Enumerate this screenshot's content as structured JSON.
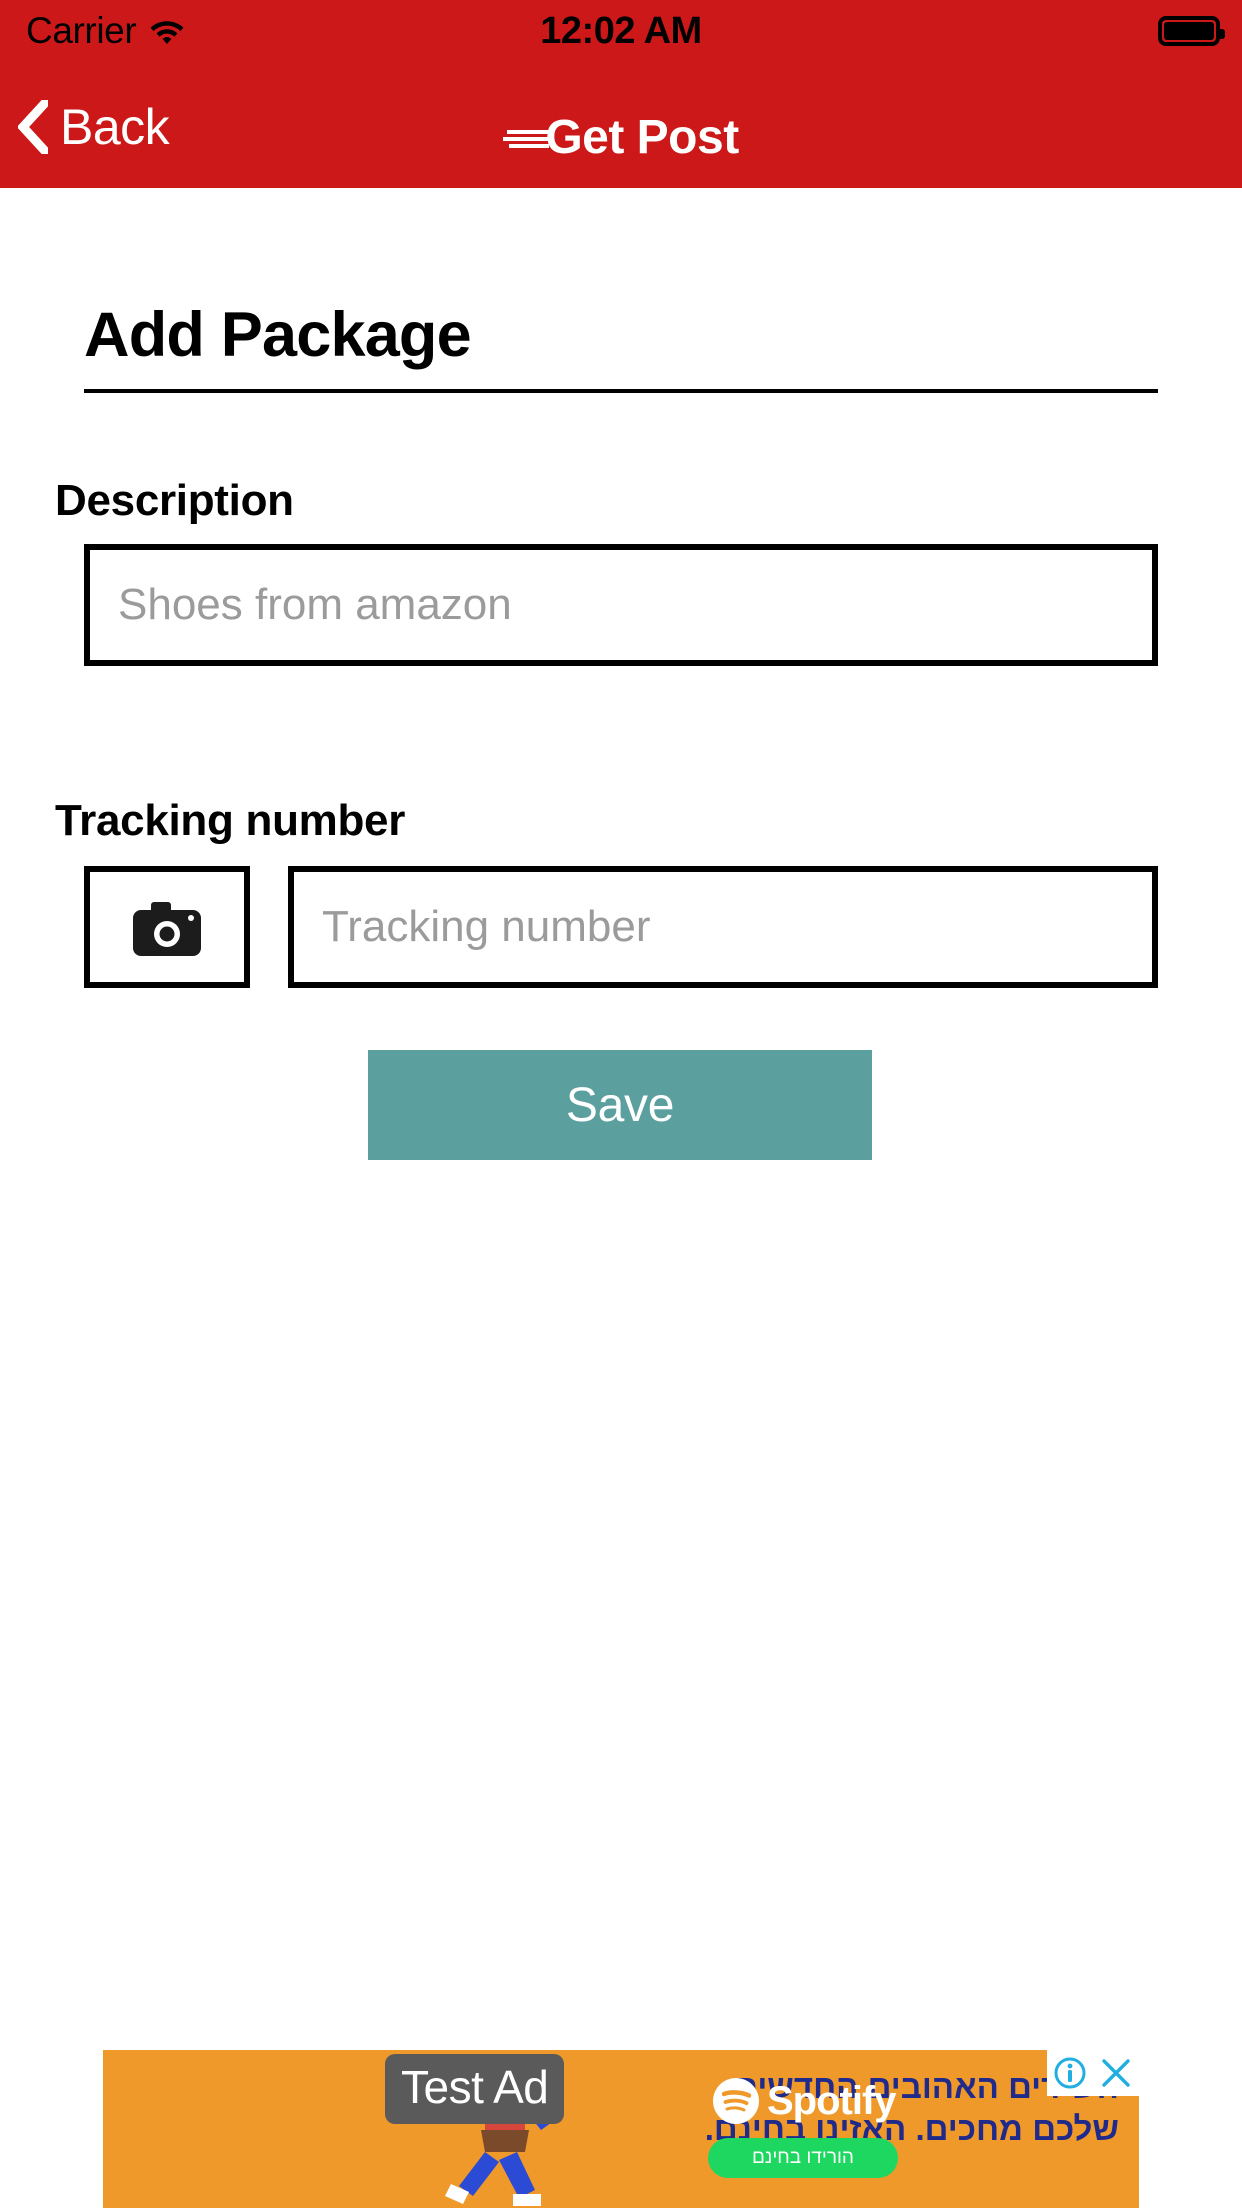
{
  "status_bar": {
    "carrier": "Carrier",
    "wifi_icon": "wifi-icon",
    "time": "12:02 AM",
    "battery_icon": "battery-full-icon"
  },
  "nav_bar": {
    "back_label": "Back",
    "back_icon": "chevron-left-icon",
    "logo_text": "Get Post",
    "logo_icon": "speed-lines-icon",
    "background_color": "#cc1818"
  },
  "page": {
    "title": "Add Package",
    "fields": [
      {
        "label": "Description",
        "placeholder": "Shoes from amazon",
        "value": ""
      },
      {
        "label": "Tracking number",
        "placeholder": "Tracking number",
        "value": "",
        "camera_icon": "camera-icon"
      }
    ],
    "save_label": "Save",
    "save_color": "#5c9f9f"
  },
  "ad": {
    "badge": "Test Ad",
    "headline": "השירים האהובים החדשים שלכם מחכים. האזינו בחינם.",
    "brand": "Spotify",
    "brand_icon": "spotify-icon",
    "cta_label": "הורידו בחינם",
    "cta_color": "#1ed760",
    "background_color": "#f0992b",
    "info_icon": "info-icon",
    "close_icon": "close-icon"
  }
}
